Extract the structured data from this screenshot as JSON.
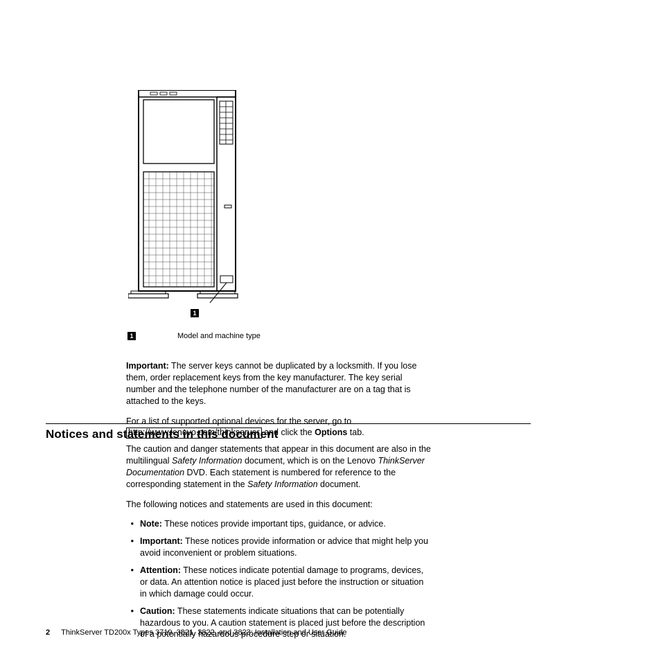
{
  "figure": {
    "callout_number": "1",
    "legend_number": "1",
    "legend_text": "Model and machine type"
  },
  "important": {
    "label": "Important:",
    "text": " The server keys cannot be duplicated by a locksmith. If you lose them, order replacement keys from the key manufacturer. The key serial number and the telephone number of the manufacturer are on a tag that is attached to the keys."
  },
  "devices": {
    "prefix": "For a list of supported optional devices for the server, go to ",
    "link": "http://www.lenovo.com/thinkserver",
    "suffix_1": " and click the ",
    "options_word": "Options",
    "suffix_2": " tab."
  },
  "heading": "Notices and statements in this document",
  "intro": {
    "t1": "The caution and danger statements that appear in this document are also in the multilingual ",
    "i1": "Safety Information",
    "t2": " document, which is on the Lenovo ",
    "i2": "ThinkServer Documentation",
    "t3": " DVD. Each statement is numbered for reference to the corresponding statement in the ",
    "i3": "Safety Information",
    "t4": " document."
  },
  "list_intro": "The following notices and statements are used in this document:",
  "items": [
    {
      "label": "Note:",
      "text": " These notices provide important tips, guidance, or advice."
    },
    {
      "label": "Important:",
      "text": " These notices provide information or advice that might help you avoid inconvenient or problem situations."
    },
    {
      "label": "Attention:",
      "text": " These notices indicate potential damage to programs, devices, or data. An attention notice is placed just before the instruction or situation in which damage could occur."
    },
    {
      "label": "Caution:",
      "text": " These statements indicate situations that can be potentially hazardous to you. A caution statement is placed just before the description of a potentially hazardous procedure step or situation."
    }
  ],
  "footer": {
    "page": "2",
    "text": "ThinkServer TD200x Types 3719, 3821, 3822, and 3823: Installation and User Guide"
  }
}
